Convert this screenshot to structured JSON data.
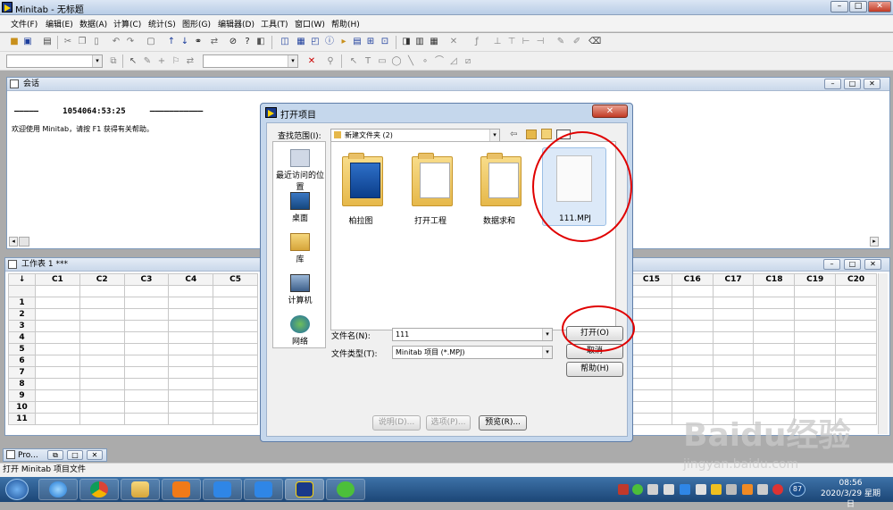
{
  "app": {
    "title": "Minitab - 无标题"
  },
  "window_controls": {
    "min": "–",
    "max": "□",
    "close": "✕"
  },
  "menu": [
    "文件(F)",
    "编辑(E)",
    "数据(A)",
    "计算(C)",
    "统计(S)",
    "图形(G)",
    "编辑器(D)",
    "工具(T)",
    "窗口(W)",
    "帮助(H)"
  ],
  "session": {
    "title": "会话",
    "line1": "—————     1054064:53:25     ———————————",
    "line2": "欢迎使用 Minitab，请按 F1 获得有关帮助。"
  },
  "worksheet": {
    "title": "工作表 1 ***",
    "arrow": "↓",
    "left_cols": [
      "C1",
      "C2",
      "C3",
      "C4",
      "C5"
    ],
    "right_cols": [
      "C15",
      "C16",
      "C17",
      "C18",
      "C19",
      "C20"
    ],
    "rows": [
      "1",
      "2",
      "3",
      "4",
      "5",
      "6",
      "7",
      "8",
      "9",
      "10",
      "11"
    ]
  },
  "dialog": {
    "title": "打开项目",
    "close": "✕",
    "look_in_label": "查找范围(I):",
    "look_in_value": "新建文件夹 (2)",
    "places": [
      "最近访问的位置",
      "桌面",
      "库",
      "计算机",
      "网络"
    ],
    "files": [
      {
        "name": "柏拉图",
        "kind": "folder"
      },
      {
        "name": "打开工程",
        "kind": "folder"
      },
      {
        "name": "数据求和",
        "kind": "folder"
      },
      {
        "name": "111.MPJ",
        "kind": "file"
      }
    ],
    "filename_label": "文件名(N):",
    "filename_value": "111",
    "filetype_label": "文件类型(T):",
    "filetype_value": "Minitab 项目 (*.MPJ)",
    "open_btn": "打开(O)",
    "cancel_btn": "取消",
    "help_btn": "帮助(H)",
    "desc_btn": "说明(D)...",
    "options_btn": "选项(P)...",
    "preview_btn": "预览(R)..."
  },
  "project_min": {
    "label": "Pro..."
  },
  "status": {
    "text": "打开 Minitab 项目文件"
  },
  "tray": {
    "badge": "87",
    "time": "08:56",
    "date": "2020/3/29 星期日"
  },
  "watermark": {
    "main": "Baidu经验",
    "sub": "jingyan.baidu.com"
  },
  "colors": {
    "highlight_ring": "#e00000",
    "taskbar": "#2a5a90"
  }
}
